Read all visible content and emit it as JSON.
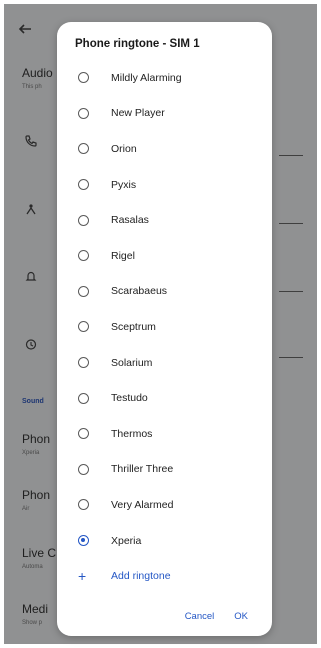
{
  "background": {
    "header_label": "Audio",
    "header_sub": "This ph",
    "section_label": "Sound",
    "entries": [
      {
        "title": "Phon",
        "sub": "Xperia"
      },
      {
        "title": "Phon",
        "sub": "Air"
      },
      {
        "title": "Live C",
        "sub": "Automa"
      },
      {
        "title": "Medi",
        "sub": "Show p"
      }
    ],
    "icons": [
      "phone-icon",
      "vibrate-icon",
      "bell-icon",
      "alarm-icon"
    ]
  },
  "dialog": {
    "title": "Phone ringtone - SIM 1",
    "options": [
      {
        "label": "Mildly Alarming",
        "selected": false
      },
      {
        "label": "New Player",
        "selected": false
      },
      {
        "label": "Orion",
        "selected": false
      },
      {
        "label": "Pyxis",
        "selected": false
      },
      {
        "label": "Rasalas",
        "selected": false
      },
      {
        "label": "Rigel",
        "selected": false
      },
      {
        "label": "Scarabaeus",
        "selected": false
      },
      {
        "label": "Sceptrum",
        "selected": false
      },
      {
        "label": "Solarium",
        "selected": false
      },
      {
        "label": "Testudo",
        "selected": false
      },
      {
        "label": "Thermos",
        "selected": false
      },
      {
        "label": "Thriller Three",
        "selected": false
      },
      {
        "label": "Very Alarmed",
        "selected": false
      },
      {
        "label": "Xperia",
        "selected": true
      }
    ],
    "add_label": "Add ringtone",
    "cancel_label": "Cancel",
    "ok_label": "OK"
  },
  "colors": {
    "accent": "#2457c5",
    "scrim": "#000000"
  }
}
